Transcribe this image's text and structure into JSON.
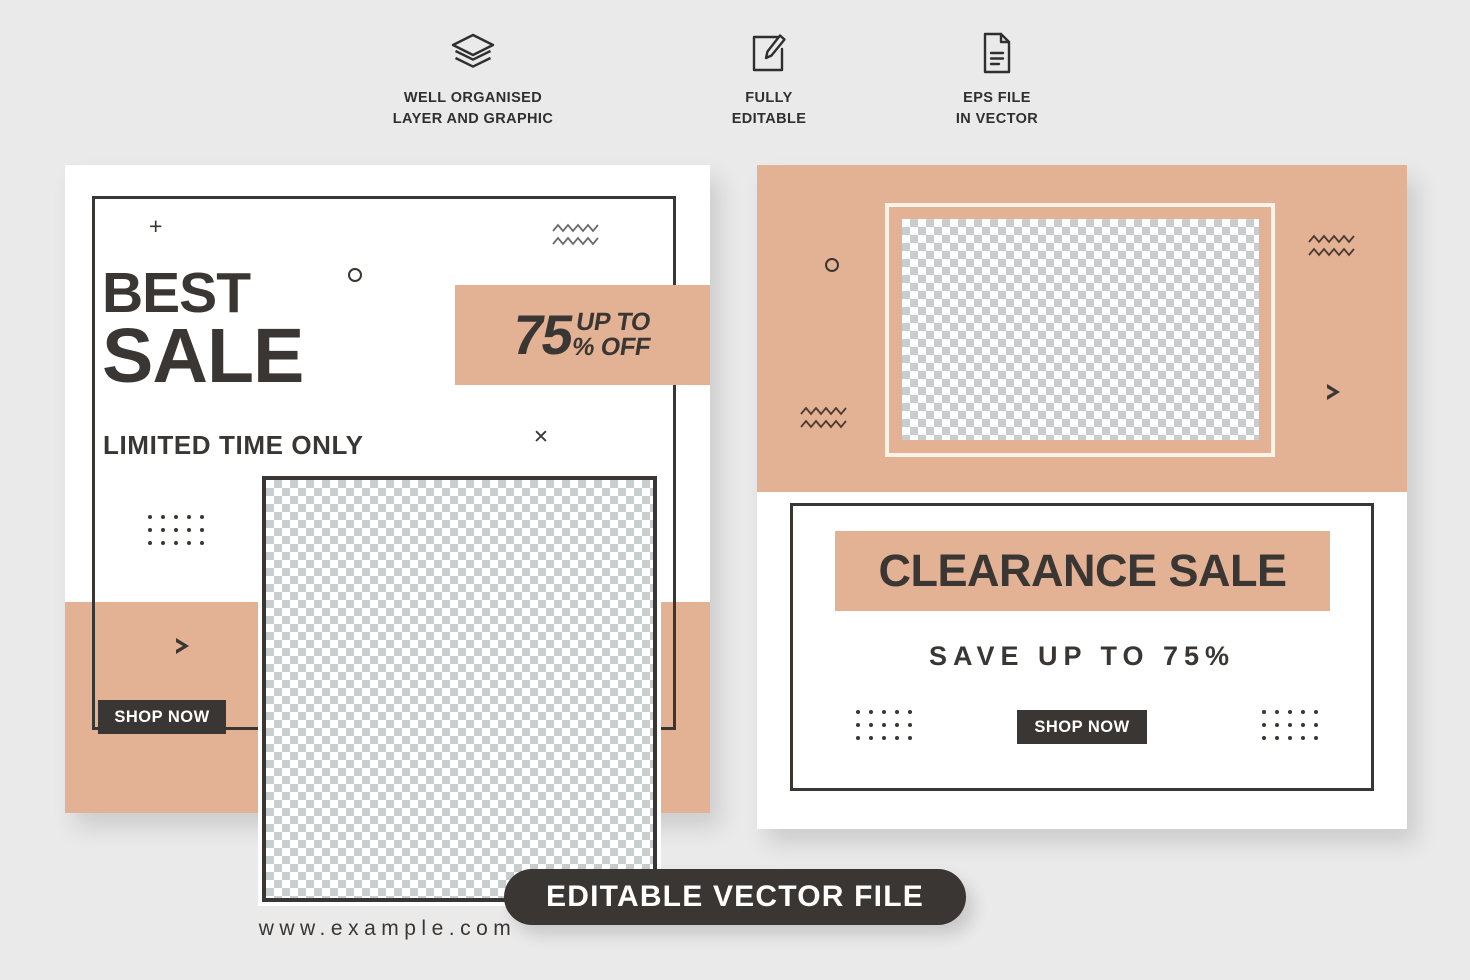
{
  "colors": {
    "background": "#eaeaea",
    "peach": "#e3b193",
    "dark": "#3a3633",
    "white": "#ffffff",
    "frame_cream": "#fdf3e8"
  },
  "features": [
    {
      "icon": "layers-icon",
      "line1": "WELL ORGANISED",
      "line2": "LAYER AND GRAPHIC"
    },
    {
      "icon": "pencil-edit-icon",
      "line1": "FULLY",
      "line2": "EDITABLE"
    },
    {
      "icon": "document-file-icon",
      "line1": "EPS FILE",
      "line2": "IN VECTOR"
    }
  ],
  "left_card": {
    "title_line1": "BEST",
    "title_line2": "SALE",
    "subtitle": "LIMITED TIME ONLY",
    "discount": {
      "number": "75",
      "up_to": "UP TO",
      "percent_off": "% OFF"
    },
    "shop_button": "SHOP NOW",
    "url": "www.example.com",
    "decorations": [
      "plus-icon",
      "circle-outline-icon",
      "zigzag-icon",
      "x-cross-icon",
      "dot-grid-icon",
      "play-triangle-icon"
    ]
  },
  "right_card": {
    "title": "CLEARANCE SALE",
    "subtitle": "SAVE UP TO 75%",
    "shop_button": "SHOP NOW",
    "decorations": [
      "circle-outline-icon",
      "zigzag-icon",
      "play-triangle-icon",
      "dot-grid-icon"
    ]
  },
  "bottom_badge": {
    "label": "EDITABLE VECTOR  FILE"
  }
}
